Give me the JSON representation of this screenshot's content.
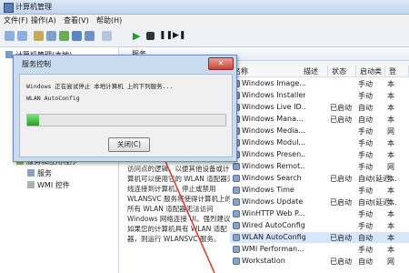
{
  "window": {
    "title": "计算机管理"
  },
  "menu": [
    "文件(F)",
    "操作(A)",
    "查看(V)",
    "帮助(H)"
  ],
  "tree": {
    "root": "计算机管理(本地)",
    "items": [
      {
        "label": "服务和应用程序"
      },
      {
        "label": "服务"
      },
      {
        "label": "WMI 控件"
      }
    ]
  },
  "panel": {
    "title": "服务"
  },
  "columns": {
    "name": "名称",
    "desc": "描述",
    "status": "状态",
    "startup": "启动类型",
    "logon": "登"
  },
  "description": "无线网络(WLAN)配置所需的逻辑。它还包含将计算机配置成软件访问点的逻辑，以便其他设备或计算机可以使用它的 WLAN 适配器无线连接到计算机。停止或禁用 WLANSVC 服务将使得计算机上的所有 WLAN 适配器无法访问 Windows 网络连接 UI。强烈建议:如果您的计算机具有 WLAN 适配器，则运行 WLANSVC 服务。",
  "services": [
    {
      "name": "Windows Image...",
      "status": "",
      "startup": "手动",
      "logon": "本"
    },
    {
      "name": "Windows Installer",
      "status": "",
      "startup": "手动",
      "logon": "本"
    },
    {
      "name": "Windows Live ID...",
      "status": "已启动",
      "startup": "自动",
      "logon": "本"
    },
    {
      "name": "Windows Mana...",
      "status": "已启动",
      "startup": "自动",
      "logon": "本"
    },
    {
      "name": "Windows Media...",
      "status": "",
      "startup": "手动",
      "logon": "网"
    },
    {
      "name": "Windows Modul...",
      "status": "",
      "startup": "手动",
      "logon": "本"
    },
    {
      "name": "Windows Presen...",
      "status": "",
      "startup": "手动",
      "logon": "本"
    },
    {
      "name": "Windows Remot...",
      "status": "",
      "startup": "手动",
      "logon": "网"
    },
    {
      "name": "Windows Search",
      "status": "已启动",
      "startup": "自动(延迟...",
      "logon": "本"
    },
    {
      "name": "Windows Time",
      "status": "",
      "startup": "手动",
      "logon": "本"
    },
    {
      "name": "Windows Update",
      "status": "已启动",
      "startup": "自动(延迟...",
      "logon": "本"
    },
    {
      "name": "WinHTTP Web P...",
      "status": "",
      "startup": "手动",
      "logon": "本"
    },
    {
      "name": "Wired AutoConfig",
      "status": "",
      "startup": "手动",
      "logon": "本"
    },
    {
      "name": "WLAN AutoConfig",
      "status": "已启动",
      "startup": "自动",
      "logon": "本"
    },
    {
      "name": "WMI Performan...",
      "status": "",
      "startup": "手动",
      "logon": "本"
    },
    {
      "name": "Workstation",
      "status": "已启动",
      "startup": "自动",
      "logon": "网"
    }
  ],
  "dialog": {
    "title": "服务控制",
    "close_x": "✕",
    "message": "Windows 正在尝试停止 本地计算机 上的下列服务...",
    "service": "WLAN AutoConfig",
    "progress": 0.06,
    "close_button": "关闭(C)"
  },
  "colors": {
    "arrow": "#e0342b",
    "progress": "#1fa31f"
  }
}
